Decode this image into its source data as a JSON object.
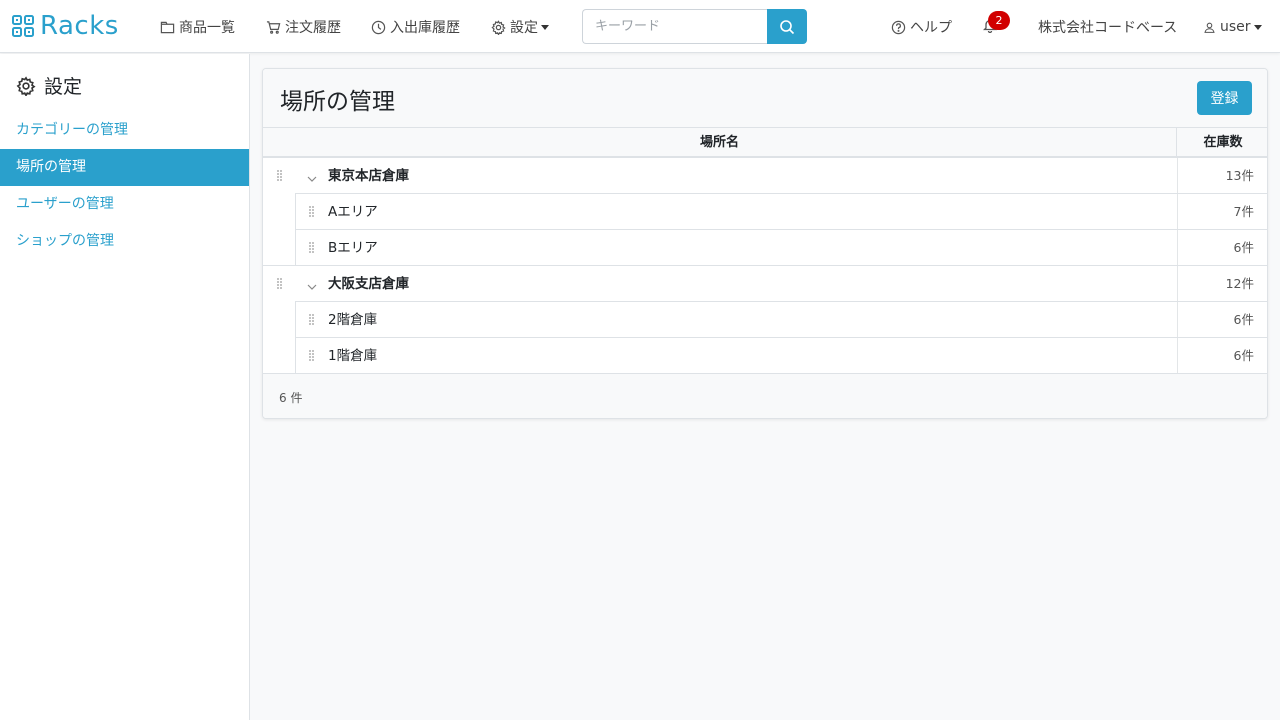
{
  "navbar": {
    "brand": "Racks",
    "links": {
      "products": "商品一覧",
      "orders": "注文履歴",
      "stock_history": "入出庫履歴",
      "settings": "設定"
    },
    "search_placeholder": "キーワード",
    "help": "ヘルプ",
    "notification_count": "2",
    "company": "株式会社コードベース",
    "user": "user"
  },
  "sidebar": {
    "title": "設定",
    "items": [
      {
        "label": "カテゴリーの管理",
        "active": false
      },
      {
        "label": "場所の管理",
        "active": true
      },
      {
        "label": "ユーザーの管理",
        "active": false
      },
      {
        "label": "ショップの管理",
        "active": false
      }
    ]
  },
  "main": {
    "title": "場所の管理",
    "register_label": "登録",
    "columns": {
      "name": "場所名",
      "stock": "在庫数"
    },
    "rows": [
      {
        "name": "東京本店倉庫",
        "count": "13件",
        "level": 0
      },
      {
        "name": "Aエリア",
        "count": "7件",
        "level": 1
      },
      {
        "name": "Bエリア",
        "count": "6件",
        "level": 1
      },
      {
        "name": "大阪支店倉庫",
        "count": "12件",
        "level": 0
      },
      {
        "name": "2階倉庫",
        "count": "6件",
        "level": 1
      },
      {
        "name": "1階倉庫",
        "count": "6件",
        "level": 1
      }
    ],
    "footer_count": "6 件"
  },
  "colors": {
    "accent": "#2aa0cc",
    "badge": "#d10000"
  }
}
